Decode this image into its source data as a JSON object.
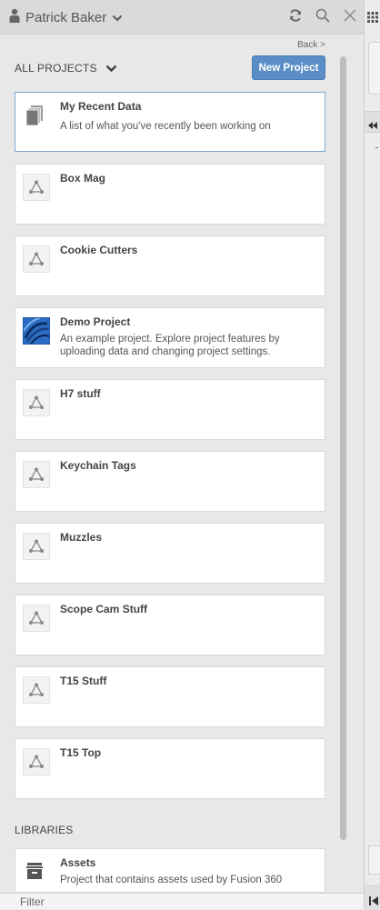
{
  "header": {
    "user_name": "Patrick Baker",
    "icons": [
      "user-icon",
      "chevron-down-icon",
      "refresh-icon",
      "search-icon",
      "close-icon"
    ]
  },
  "nav": {
    "back_label": "Back >"
  },
  "projects": {
    "section_label": "ALL PROJECTS",
    "new_button_label": "New Project",
    "items": [
      {
        "title": "My Recent Data",
        "description": "A list of what you've recently been working on",
        "icon": "documents-icon"
      },
      {
        "title": "Box Mag",
        "description": "",
        "icon": "project-icon"
      },
      {
        "title": "Cookie Cutters",
        "description": "",
        "icon": "project-icon"
      },
      {
        "title": "Demo Project",
        "description": "An example project. Explore project features by uploading data and changing project settings.",
        "icon": "demo-thumbnail-icon"
      },
      {
        "title": "H7 stuff",
        "description": "",
        "icon": "project-icon"
      },
      {
        "title": "Keychain Tags",
        "description": "",
        "icon": "project-icon"
      },
      {
        "title": "Muzzles",
        "description": "",
        "icon": "project-icon"
      },
      {
        "title": "Scope Cam Stuff",
        "description": "",
        "icon": "project-icon"
      },
      {
        "title": "T15 Stuff",
        "description": "",
        "icon": "project-icon"
      },
      {
        "title": "T15 Top",
        "description": "",
        "icon": "project-icon"
      }
    ]
  },
  "libraries": {
    "section_label": "LIBRARIES",
    "items": [
      {
        "title": "Assets",
        "description": "Project that contains assets used by Fusion 360",
        "icon": "library-icon"
      }
    ]
  },
  "filter": {
    "placeholder": "Filter"
  },
  "colors": {
    "accent": "#5b8ec6",
    "selected_border": "#7da7d3",
    "panel_bg": "#e8e8e8"
  }
}
